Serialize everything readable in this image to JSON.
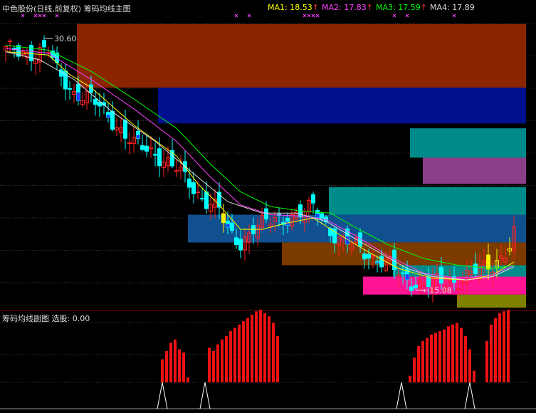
{
  "header": {
    "title": "中色股份(日线,前复权) 筹码均线主图",
    "ma": [
      {
        "label": "MA1: 18.53",
        "color": "#ffff00"
      },
      {
        "label": "MA2: 17.83",
        "color": "#ff40ff"
      },
      {
        "label": "MA3: 17.59",
        "color": "#00ff00"
      },
      {
        "label": "MA4: 17.89",
        "color": "#dddddd"
      }
    ],
    "arrow": "↑",
    "arrow_color": "#ff3030"
  },
  "sub": {
    "title": "筹码均线副图  选股: 0.00"
  },
  "chart_data": [
    {
      "type": "candlestick",
      "title": "筹码均线主图",
      "y_range": [
        14.0,
        32.0
      ],
      "annotations": [
        {
          "text": "30.60",
          "index": 9,
          "value": 30.6,
          "kind": "high"
        },
        {
          "text": "15.08",
          "index": 96,
          "value": 15.08,
          "kind": "low"
        }
      ],
      "chip_bands": [
        {
          "from": 27.5,
          "to": 31.4,
          "start_index": 17,
          "color": "#8b2500"
        },
        {
          "from": 25.3,
          "to": 27.5,
          "start_index": 36,
          "color": "#00108e"
        },
        {
          "from": 23.2,
          "to": 25.0,
          "start_index": 95,
          "color": "#008b8b"
        },
        {
          "from": 21.6,
          "to": 23.2,
          "start_index": 98,
          "color": "#8b3f8b"
        },
        {
          "from": 19.7,
          "to": 21.4,
          "start_index": 76,
          "color": "#008b8b"
        },
        {
          "from": 18.0,
          "to": 19.7,
          "start_index": 43,
          "color": "#10508e"
        },
        {
          "from": 16.6,
          "to": 18.0,
          "start_index": 65,
          "color": "#7a3a00"
        },
        {
          "from": 15.9,
          "to": 16.6,
          "start_index": 91,
          "color": "#008b8b"
        },
        {
          "from": 14.8,
          "to": 15.9,
          "start_index": 84,
          "color": "#ff1493"
        },
        {
          "from": 14.0,
          "to": 14.8,
          "start_index": 106,
          "color": "#808000"
        }
      ],
      "top_markers": [
        2,
        5,
        6,
        7,
        10,
        52,
        55,
        68,
        69,
        70,
        71,
        89,
        92,
        103
      ],
      "close_path": [
        [
          0,
          29.8
        ],
        [
          5,
          29.6
        ],
        [
          10,
          29.8
        ],
        [
          12,
          28.5
        ],
        [
          16,
          27.2
        ],
        [
          20,
          26.8
        ],
        [
          25,
          25.5
        ],
        [
          30,
          24.0
        ],
        [
          35,
          23.5
        ],
        [
          40,
          22.5
        ],
        [
          45,
          21.0
        ],
        [
          50,
          20.0
        ],
        [
          52,
          18.6
        ],
        [
          55,
          18.0
        ],
        [
          58,
          18.9
        ],
        [
          63,
          19.4
        ],
        [
          70,
          19.8
        ],
        [
          72,
          20.2
        ],
        [
          74,
          19.5
        ],
        [
          78,
          18.1
        ],
        [
          82,
          17.8
        ],
        [
          86,
          17.1
        ],
        [
          90,
          16.6
        ],
        [
          93,
          15.8
        ],
        [
          96,
          15.5
        ],
        [
          100,
          15.5
        ],
        [
          105,
          15.6
        ],
        [
          110,
          16.2
        ],
        [
          114,
          16.6
        ],
        [
          118,
          17.8
        ],
        [
          119,
          18.5
        ]
      ],
      "ma_paths": [
        {
          "name": "MA1",
          "color": "#ffff00",
          "points": [
            [
              0,
              29.7
            ],
            [
              10,
              29.5
            ],
            [
              15,
              28.3
            ],
            [
              20,
              27.5
            ],
            [
              30,
              25.2
            ],
            [
              40,
              23.3
            ],
            [
              45,
              21.6
            ],
            [
              50,
              20.3
            ],
            [
              55,
              18.8
            ],
            [
              60,
              18.8
            ],
            [
              66,
              19.2
            ],
            [
              72,
              19.5
            ],
            [
              78,
              18.5
            ],
            [
              85,
              17.4
            ],
            [
              92,
              16.4
            ],
            [
              100,
              15.8
            ],
            [
              108,
              15.7
            ],
            [
              114,
              16.0
            ],
            [
              119,
              16.8
            ]
          ]
        },
        {
          "name": "MA2",
          "color": "#ff40ff",
          "points": [
            [
              0,
              29.9
            ],
            [
              10,
              29.6
            ],
            [
              20,
              28.0
            ],
            [
              30,
              26.2
            ],
            [
              40,
              24.2
            ],
            [
              48,
              22.0
            ],
            [
              55,
              20.3
            ],
            [
              62,
              19.7
            ],
            [
              70,
              19.6
            ],
            [
              75,
              19.4
            ],
            [
              82,
              18.4
            ],
            [
              90,
              17.1
            ],
            [
              98,
              16.1
            ],
            [
              106,
              15.8
            ],
            [
              114,
              16.0
            ],
            [
              119,
              16.6
            ]
          ]
        },
        {
          "name": "MA3",
          "color": "#00ff00",
          "points": [
            [
              0,
              30.1
            ],
            [
              10,
              29.8
            ],
            [
              20,
              28.5
            ],
            [
              30,
              26.8
            ],
            [
              40,
              25.0
            ],
            [
              48,
              22.8
            ],
            [
              55,
              21.1
            ],
            [
              62,
              20.2
            ],
            [
              70,
              19.9
            ],
            [
              76,
              19.8
            ],
            [
              82,
              18.9
            ],
            [
              90,
              17.8
            ],
            [
              98,
              17.0
            ],
            [
              106,
              16.6
            ],
            [
              114,
              16.4
            ],
            [
              119,
              16.6
            ]
          ]
        },
        {
          "name": "MA4",
          "color": "#dddddd",
          "points": [
            [
              0,
              29.7
            ],
            [
              8,
              29.2
            ],
            [
              16,
              28.0
            ],
            [
              25,
              26.0
            ],
            [
              35,
              24.2
            ],
            [
              45,
              22.0
            ],
            [
              52,
              20.5
            ],
            [
              60,
              19.8
            ],
            [
              68,
              19.8
            ],
            [
              75,
              19.3
            ],
            [
              82,
              18.2
            ],
            [
              88,
              17.3
            ],
            [
              94,
              16.4
            ],
            [
              100,
              15.9
            ],
            [
              108,
              15.7
            ],
            [
              114,
              15.9
            ],
            [
              119,
              16.5
            ]
          ]
        }
      ]
    },
    {
      "type": "bar",
      "title": "筹码均线副图",
      "y_range": [
        0,
        100
      ],
      "bar_groups": [
        {
          "start": 37,
          "values": [
            28,
            38,
            48,
            52,
            40,
            36,
            6
          ]
        },
        {
          "start": 48,
          "values": [
            42,
            38,
            46,
            52,
            56,
            62,
            66,
            70,
            74,
            78,
            82,
            86,
            88,
            84,
            80,
            72,
            56
          ]
        },
        {
          "start": 95,
          "values": [
            8,
            30,
            44,
            50,
            54,
            58,
            60,
            62,
            64,
            68,
            70,
            72,
            66,
            56,
            40,
            14
          ]
        },
        {
          "start": 113,
          "values": [
            50,
            70,
            78,
            84,
            86,
            88
          ]
        }
      ],
      "spikes": [
        37,
        47,
        93,
        109
      ]
    }
  ]
}
